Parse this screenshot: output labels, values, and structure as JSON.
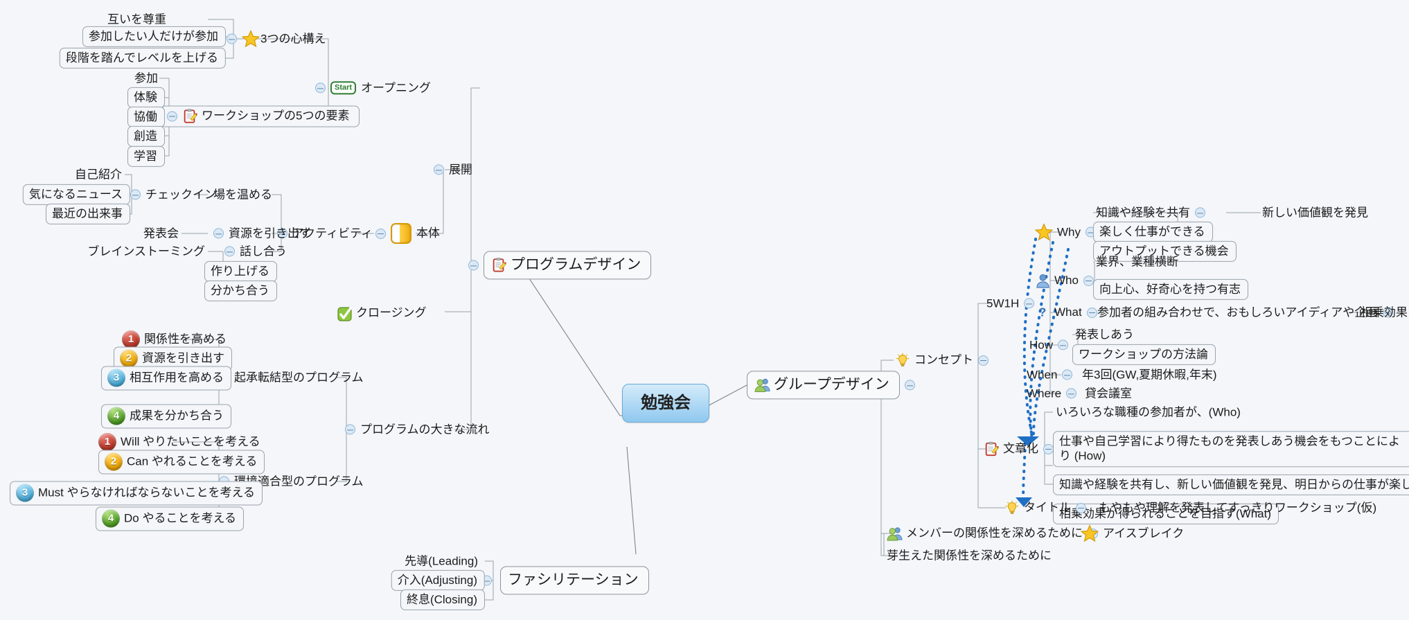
{
  "map": {
    "root": {
      "label": "勉強会",
      "icon": "root-node"
    },
    "branches": [
      {
        "id": "program-design",
        "label": "プログラムデザイン",
        "icon": "clipboard-pencil-icon"
      },
      {
        "id": "group-design",
        "label": "グループデザイン",
        "icon": "people-icon"
      },
      {
        "id": "facilitation",
        "label": "ファシリテーション",
        "icon": "none"
      }
    ]
  },
  "program_design": {
    "opening": {
      "label": "オープニング",
      "icon": "start-badge-icon",
      "mindset": {
        "label": "3つの心構え",
        "icon": "star-icon",
        "items": [
          "互いを尊重",
          "参加したい人だけが参加",
          "段階を踏んでレベルを上げる"
        ]
      },
      "five_elements": {
        "label": "ワークショップの5つの要素",
        "icon": "clipboard-pencil-icon",
        "items": [
          "参加",
          "体験",
          "協働",
          "創造",
          "学習"
        ]
      }
    },
    "development": {
      "label": "展開"
    },
    "main_body": {
      "label": "本体",
      "icon": "flag-box-icon",
      "activity": {
        "label": "アクティビティ",
        "warmup": {
          "label": "場を温める",
          "checkin": {
            "label": "チェックイン",
            "items": [
              "自己紹介",
              "気になるニュース",
              "最近の出来事"
            ]
          }
        },
        "draw_out": {
          "label": "資源を引き出す",
          "items": [
            "発表会"
          ]
        },
        "discuss": {
          "label": "話し合う",
          "items": [
            "ブレインストーミング",
            "作り上げる",
            "分かち合う"
          ]
        }
      }
    },
    "closing": {
      "label": "クロージング",
      "icon": "green-check-icon"
    },
    "big_flow": {
      "label": "プログラムの大きな流れ",
      "kishotenketsu": {
        "label": "起承転結型のプログラム",
        "items": [
          {
            "num": "1",
            "text": "関係性を高める",
            "color": "#c0392b"
          },
          {
            "num": "2",
            "text": "資源を引き出す",
            "color": "#f0a808"
          },
          {
            "num": "3",
            "text": "相互作用を高める",
            "color": "#4fb3e0"
          },
          {
            "num": "4",
            "text": "成果を分かち合う",
            "color": "#53a226"
          }
        ]
      },
      "adaptive": {
        "label": "環境適合型のプログラム",
        "items": [
          {
            "num": "1",
            "text": "Will やりたいことを考える",
            "color": "#c0392b"
          },
          {
            "num": "2",
            "text": "Can やれることを考える",
            "color": "#f0a808"
          },
          {
            "num": "3",
            "text": "Must やらなければならないことを考える",
            "color": "#4fb3e0"
          },
          {
            "num": "4",
            "text": "Do やることを考える",
            "color": "#53a226"
          }
        ]
      }
    }
  },
  "group_design": {
    "concept": {
      "label": "コンセプト",
      "icon": "lightbulb-icon",
      "w5h1": {
        "label": "5W1H",
        "rows": [
          {
            "key": "Why",
            "icon": "star-icon",
            "values": [
              "楽しく仕事ができる",
              "アウトプットできる機会"
            ],
            "above": "知識や経験を共有",
            "above_child": "新しい価値観を発見"
          },
          {
            "key": "Who",
            "icon": "person-icon",
            "values": [
              "向上心、好奇心を持つ有志"
            ],
            "above": "業界、業種横断"
          },
          {
            "key": "What",
            "icon": "question-icon",
            "values": [
              "参加者の組み合わせで、おもしろいアイディアや企画"
            ],
            "child": "相乗効果"
          },
          {
            "key": "How",
            "icon": "none",
            "values": [
              "ワークショップの方法論"
            ],
            "above": "発表しあう"
          },
          {
            "key": "When",
            "icon": "none",
            "values": [
              "年3回(GW,夏期休暇,年末)"
            ]
          },
          {
            "key": "Where",
            "icon": "none",
            "values": [
              "貸会議室"
            ]
          }
        ]
      },
      "sentence": {
        "label": "文章化",
        "icon": "clipboard-pencil-icon",
        "above": "いろいろな職種の参加者が、(Who)",
        "items": [
          "仕事や自己学習により得たものを発表しあう機会をもつことにより (How)",
          "知識や経験を共有し、新しい価値観を発見、明日からの仕事が楽しくなる(Why)",
          "相乗効果が得られることを目指す(What)"
        ]
      },
      "title": {
        "label": "タイトル",
        "icon": "lightbulb-icon",
        "value": "もやもや理解を発表してすっきりワークショップ(仮)"
      }
    },
    "relationship": {
      "label": "メンバーの関係性を深めるために",
      "icon": "people-icon",
      "icebreak": {
        "label": "アイスブレイク",
        "icon": "star-icon"
      },
      "below": "芽生えた関係性を深めるために"
    }
  },
  "facilitation": {
    "label": "ファシリテーション",
    "items": [
      "先導(Leading)",
      "介入(Adjusting)",
      "終息(Closing)"
    ]
  },
  "colors": {
    "background": "#f4f6f9",
    "root_fill": "#aed8f4",
    "wire": "#9aa3ad",
    "dotted_arrow": "#1f6fc4",
    "bubble": "#dce9f5"
  }
}
